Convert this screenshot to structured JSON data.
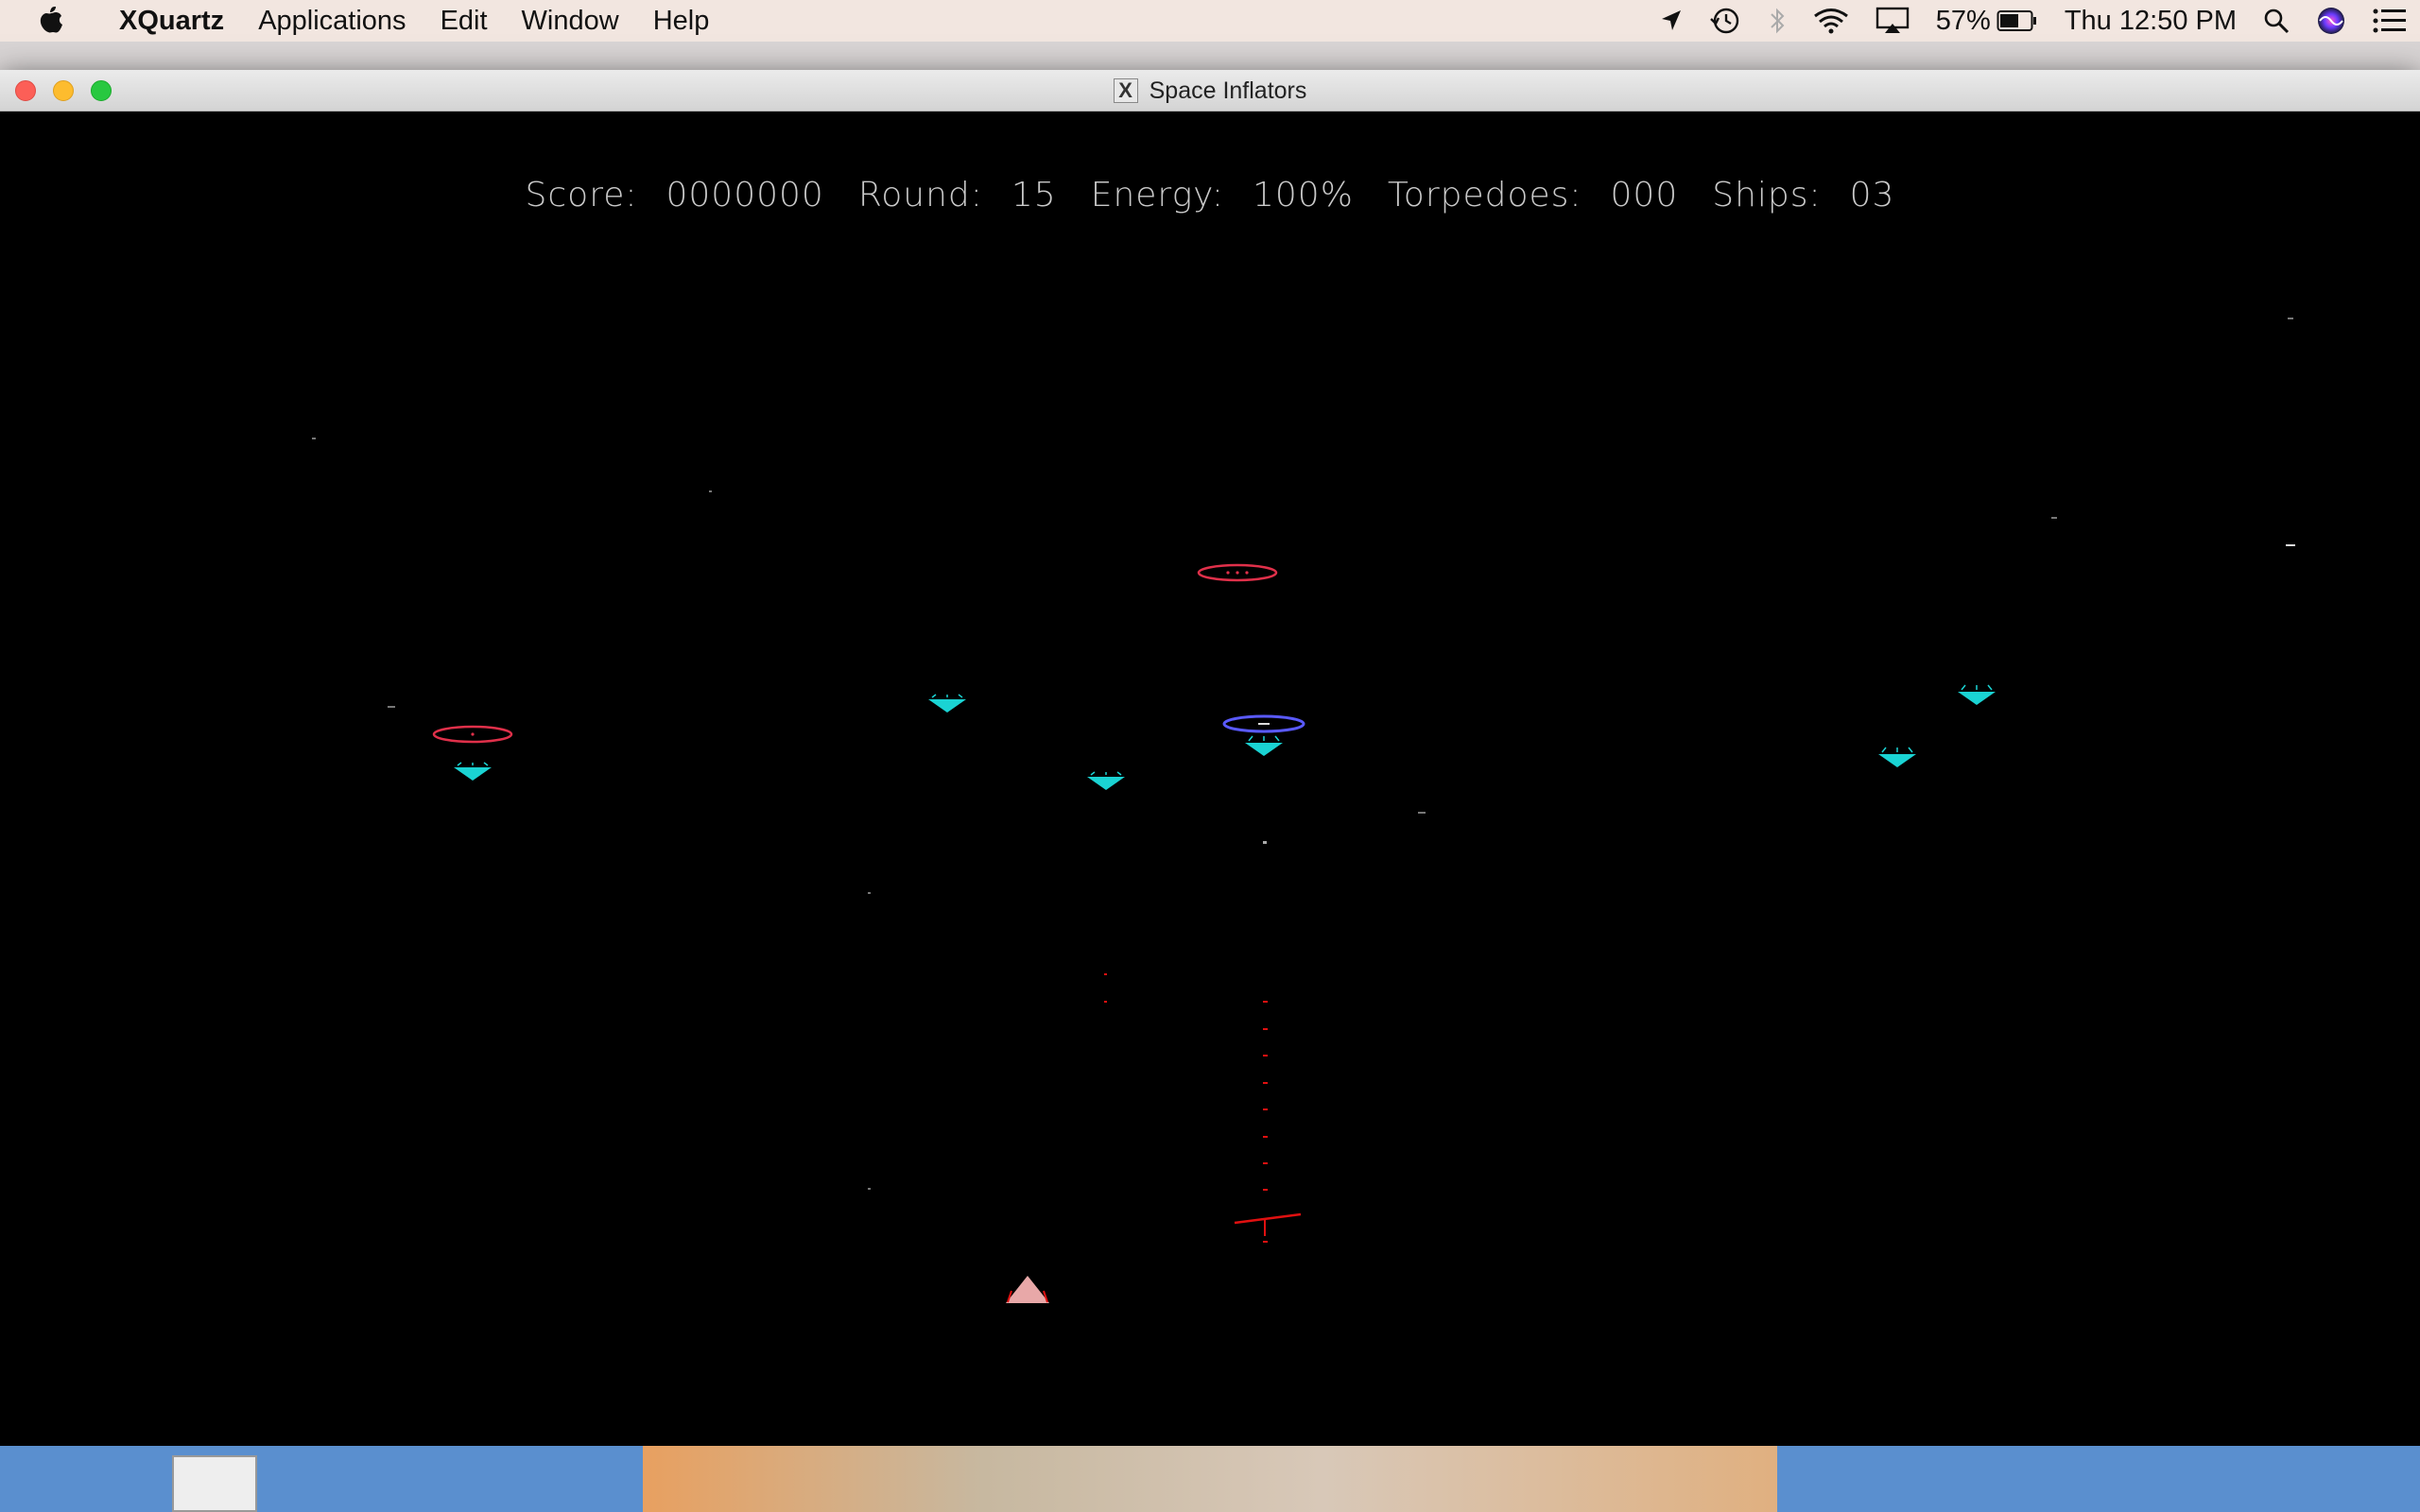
{
  "menubar": {
    "apple_icon": "apple-icon",
    "app_name": "XQuartz",
    "items": [
      "Applications",
      "Edit",
      "Window",
      "Help"
    ],
    "status": {
      "battery_percent": "57%",
      "clock": "Thu 12:50 PM"
    }
  },
  "window": {
    "title": "Space Inflators",
    "title_icon_glyph": "X"
  },
  "hud": {
    "score_label": "Score:",
    "score_value": "0000000",
    "round_label": "Round:",
    "round_value": "15",
    "energy_label": "Energy:",
    "energy_value": "100%",
    "torpedoes_label": "Torpedoes:",
    "torpedoes_value": "000",
    "ships_label": "Ships:",
    "ships_value": "03"
  },
  "colors": {
    "menubar_bg": "#f2e6e0",
    "game_bg": "#000000",
    "hud_text": "#c9c9c9",
    "alien_cyan": "#1ad3d3",
    "saucer_red": "#e0304a",
    "saucer_blue": "#5a5aff",
    "laser_red": "#e01010",
    "player_ship": "#e8a8a8"
  }
}
